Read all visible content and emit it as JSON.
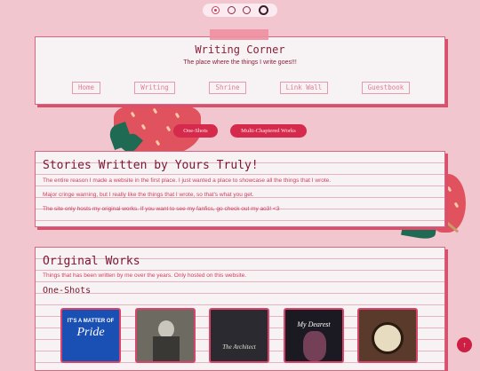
{
  "pager": {
    "dots": [
      "active",
      "hollow-pink",
      "hollow",
      "dark"
    ]
  },
  "header": {
    "title": "Writing Corner",
    "subtitle": "The place where the things I write goes!!!",
    "nav": [
      "Home",
      "Writing",
      "Shrine",
      "Link Wall",
      "Guestbook"
    ]
  },
  "filters": {
    "one_shots": "One-Shots",
    "multi": "Multi-Chaptered Works"
  },
  "intro": {
    "title": "Stories Written by Yours Truly!",
    "lines": [
      "The entire reason I made a website in the first place. I just wanted a place to showcase all the things that I wrote.",
      "Major cringe warning, but I really like the things that I wrote, so that's what you get.",
      "The site only hosts my original works. If you want to see my fanfics, go check out my ao3! <3"
    ]
  },
  "original": {
    "title": "Original Works",
    "subtitle": "Things that has been written by me over the years. Only hosted on this website.",
    "section": "One-Shots",
    "covers": [
      {
        "title_top": "IT'S A MATTER OF",
        "title_main": "Pride",
        "color": "#1a4fb3"
      },
      {
        "title_top": "",
        "title_main": "",
        "color": "#6d6a62"
      },
      {
        "title_top": "",
        "title_main": "The Architect",
        "color": "#2a2a30"
      },
      {
        "title_top": "",
        "title_main": "My Dearest",
        "color": "#1b1a22"
      },
      {
        "title_top": "",
        "title_main": "",
        "color": "#5a3a2a"
      }
    ]
  },
  "scroll_top": "↑"
}
